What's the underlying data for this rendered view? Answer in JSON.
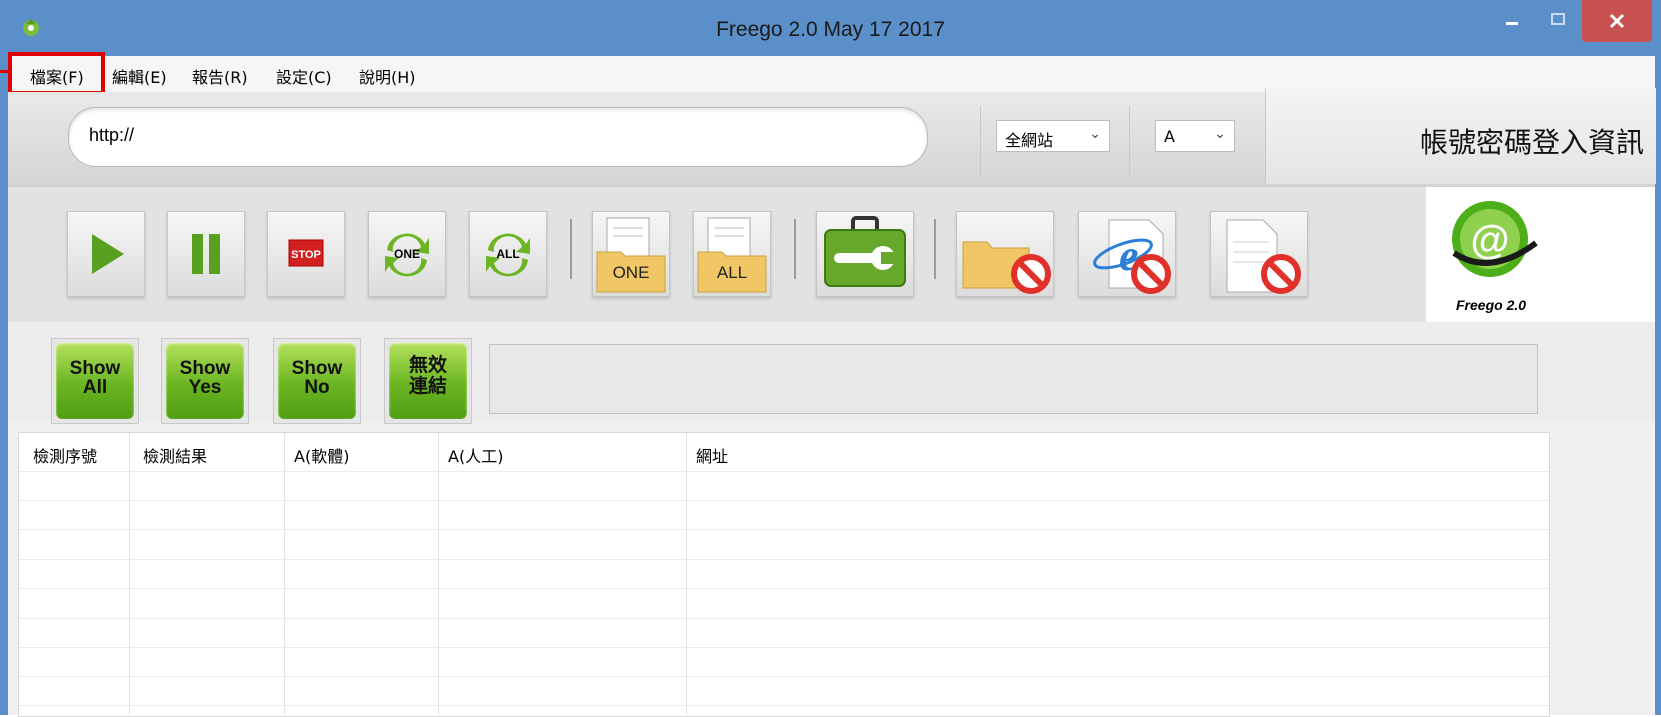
{
  "window": {
    "title": "Freego 2.0 May 17 2017",
    "minimize_label": "–",
    "maximize_label": "□",
    "close_label": "×"
  },
  "menu": {
    "items": [
      {
        "label": "檔案(F)"
      },
      {
        "label": "編輯(E)"
      },
      {
        "label": "報告(R)"
      },
      {
        "label": "設定(C)"
      },
      {
        "label": "說明(H)"
      }
    ]
  },
  "address": {
    "url_value": "http://",
    "scope_select": "全網站",
    "level_select": "A",
    "login_label": "帳號密碼登入資訊"
  },
  "toolbar": {
    "stop_label": "STOP",
    "refresh_one_label": "ONE",
    "refresh_all_label": "ALL",
    "folder_one_label": "ONE",
    "folder_all_label": "ALL",
    "logo_text": "Freego 2.0"
  },
  "filters": {
    "show_all": "Show\nAll",
    "show_yes": "Show\nYes",
    "show_no": "Show\nNo",
    "invalid_links": "無效\n連結"
  },
  "table": {
    "columns": [
      "檢測序號",
      "檢測結果",
      "A(軟體)",
      "A(人工)",
      "網址"
    ],
    "rows": []
  },
  "colors": {
    "titlebar": "#5b8fc9",
    "close_button": "#c75050",
    "highlight": "#e00000",
    "green_button": "#6ab521"
  }
}
